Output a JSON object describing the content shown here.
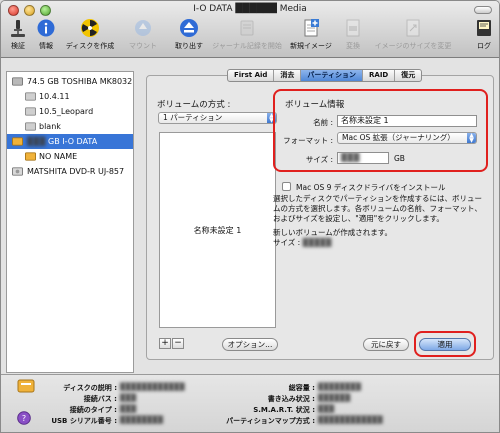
{
  "window": {
    "title": "I-O DATA ██████ Media"
  },
  "toolbar": {
    "verify": "検証",
    "info": "情報",
    "burn": "ディスクを作成",
    "mount": "マウント",
    "eject": "取り出す",
    "journal": "ジャーナル記録を開始",
    "new_image": "新規イメージ",
    "convert": "変換",
    "resize_image": "イメージのサイズを変更",
    "log": "ログ"
  },
  "sidebar": {
    "items": [
      {
        "label": "74.5 GB TOSHIBA MK8032..."
      },
      {
        "label": "10.4.11"
      },
      {
        "label": "10.5_Leopard"
      },
      {
        "label": "blank"
      },
      {
        "label": "GB I-O DATA"
      },
      {
        "label": "NO NAME"
      },
      {
        "label": "MATSHITA DVD-R UJ-857"
      }
    ]
  },
  "tabs": [
    "First Aid",
    "消去",
    "パーティション",
    "RAID",
    "復元"
  ],
  "partition": {
    "scheme_label": "ボリュームの方式 :",
    "scheme_value": "1 パーティション",
    "layout_volume_name": "名称未設定 1",
    "info_title": "ボリューム情報",
    "name_label": "名前 :",
    "name_value": "名称未設定 1",
    "format_label": "フォーマット :",
    "format_value": "Mac OS 拡張（ジャーナリング）",
    "size_label": "サイズ :",
    "size_value": "███",
    "size_unit": "GB",
    "os9_checkbox": "Mac OS 9 ディスクドライバをインストール",
    "description": "選択したディスクでパーティションを作成するには、ボリュームの方式を選択します。各ボリュームの名前、フォーマット、およびサイズを設定し、\"適用\"をクリックします。",
    "new_volume_msg": "新しいボリュームが作成されます。",
    "size_line_label": "サイズ :",
    "size_line_value": "█████",
    "add": "+",
    "remove": "−",
    "options_button": "オプション...",
    "revert_button": "元に戻す",
    "apply_button": "適用"
  },
  "status": {
    "disk_desc_label": "ディスクの説明 :",
    "disk_desc_value": "████████████",
    "bus_label": "接続バス :",
    "bus_value": "███",
    "conn_type_label": "接続のタイプ :",
    "conn_type_value": "███",
    "serial_label": "USB シリアル番号 :",
    "serial_value": "████████",
    "capacity_label": "総容量 :",
    "capacity_value": "████████",
    "write_status_label": "書き込み状況 :",
    "write_status_value": "██████",
    "smart_label": "S.M.A.R.T. 状況 :",
    "smart_value": "███",
    "map_label": "パーティションマップ方式 :",
    "map_value": "████████████"
  }
}
